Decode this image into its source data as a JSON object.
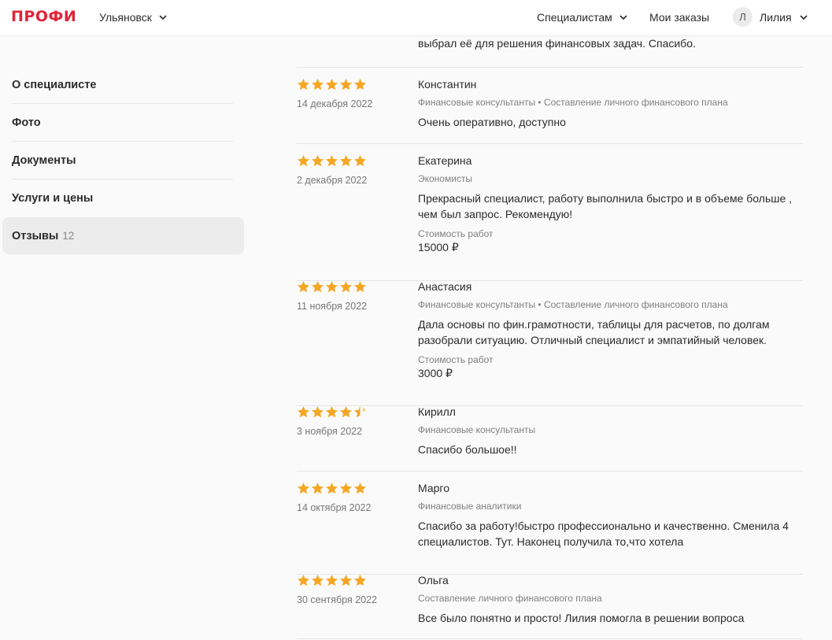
{
  "header": {
    "logo": "ПРОФИ",
    "city": "Ульяновск",
    "specialists": "Специалистам",
    "orders": "Мои заказы",
    "user_initial": "Л",
    "user_name": "Лилия",
    "brand_color": "#e0243a"
  },
  "sidebar": {
    "items": [
      {
        "label": "О специалисте"
      },
      {
        "label": "Фото"
      },
      {
        "label": "Документы"
      },
      {
        "label": "Услуги и цены"
      },
      {
        "label": "Отзывы",
        "count": "12"
      }
    ]
  },
  "reviews": {
    "previous_tail": "выбрал её для решения финансовых задач. Спасибо.",
    "cost_label": "Стоимость работ",
    "star_color": "#f5a623",
    "items": [
      {
        "rating": 5,
        "date": "14 декабря 2022",
        "name": "Константин",
        "category": "Финансовые консультанты • Составление личного финансового плана",
        "text": "Очень оперативно, доступно"
      },
      {
        "rating": 5,
        "date": "2 декабря 2022",
        "name": "Екатерина",
        "category": "Экономисты",
        "text": "Прекрасный специалист, работу выполнила быстро и в объеме больше , чем был запрос. Рекомендую!",
        "cost": "15000 ₽"
      },
      {
        "rating": 5,
        "date": "11 ноября 2022",
        "name": "Анастасия",
        "category": "Финансовые консультанты • Составление личного финансового плана",
        "text": "Дала основы по фин.грамотности, таблицы для расчетов, по долгам разобрали ситуацию. Отличный специалист и эмпатийный человек.",
        "cost": "3000 ₽"
      },
      {
        "rating": 4.5,
        "date": "3 ноября 2022",
        "name": "Кирилл",
        "category": "Финансовые консультанты",
        "text": "Спасибо большое!!"
      },
      {
        "rating": 5,
        "date": "14 октября 2022",
        "name": "Марго",
        "category": "Финансовые аналитики",
        "text": "Спасибо за работу!быстро профессионально и качественно. Сменила 4 специалистов. Тут. Наконец получила то,что хотела"
      },
      {
        "rating": 5,
        "date": "30 сентября 2022",
        "name": "Ольга",
        "category": "Составление личного финансового плана",
        "text": "Все было понятно и просто! Лилия помогла в решении вопроса"
      }
    ]
  }
}
